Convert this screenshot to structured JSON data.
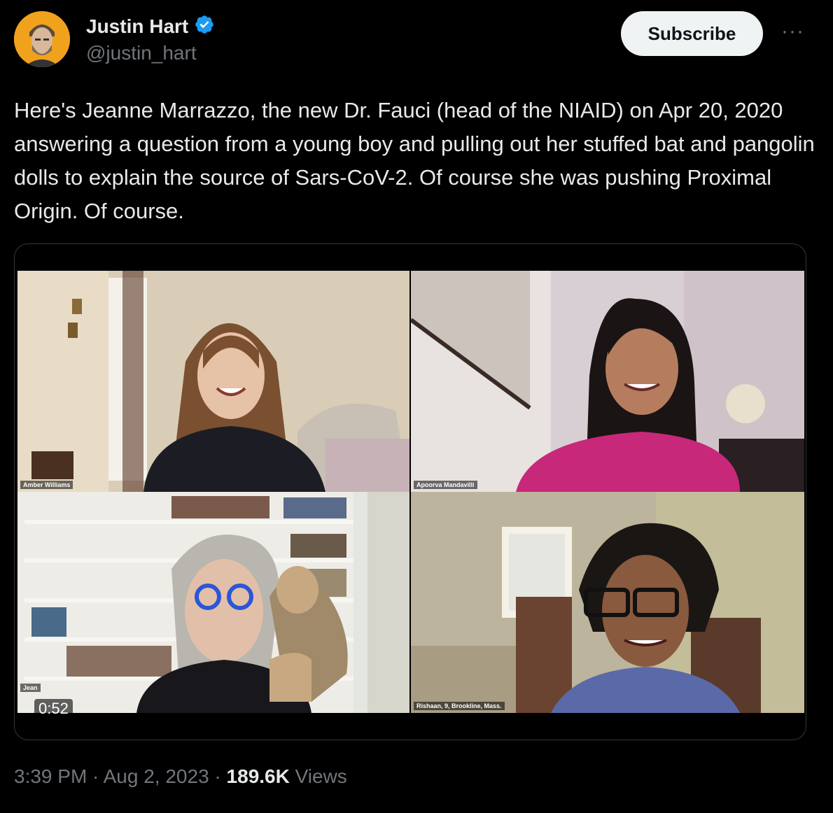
{
  "author": {
    "name": "Justin Hart",
    "handle": "@justin_hart",
    "verified_color": "#1d9bf0",
    "avatar_bg": "#f1a21d"
  },
  "actions": {
    "subscribe_label": "Subscribe",
    "more_label": "···"
  },
  "tweet": {
    "text": "Here's Jeanne Marrazzo, the new Dr. Fauci (head of the NIAID) on Apr 20, 2020 answering a question from a young boy and pulling out her stuffed bat and pangolin dolls to explain the source of Sars-CoV-2. Of course she was pushing Proximal Origin. Of course."
  },
  "video": {
    "duration": "0:52",
    "participants": [
      {
        "label": "Amber Williams"
      },
      {
        "label": "Apoorva Mandavilli"
      },
      {
        "label": "Jean"
      },
      {
        "label": "Rishaan, 9, Brookline, Mass."
      }
    ]
  },
  "meta": {
    "time": "3:39 PM",
    "sep1": " · ",
    "date": "Aug 2, 2023",
    "sep2": " · ",
    "views_count": "189.6K",
    "views_label": " Views"
  }
}
